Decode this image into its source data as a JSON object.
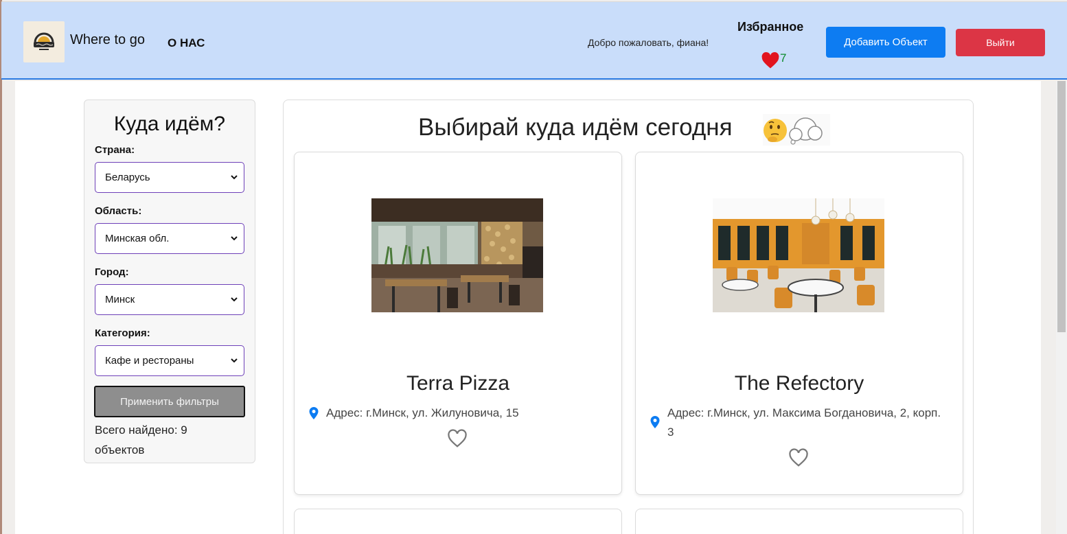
{
  "header": {
    "brand": "Where to go",
    "about_label": "О НАС",
    "welcome": "Добро пожаловать, фиана!",
    "favorites_label": "Избранное",
    "favorites_count": "7",
    "add_object_label": "Добавить Объект",
    "logout_label": "Выйти",
    "colors": {
      "header_bg": "#c9ddfa",
      "add_button": "#0d7cf2",
      "logout_button": "#dc3545",
      "favorites_count": "#0a8a2a"
    }
  },
  "filters": {
    "title": "Куда идём?",
    "country_label": "Страна:",
    "country_value": "Беларусь",
    "region_label": "Область:",
    "region_value": "Минская обл.",
    "city_label": "Город:",
    "city_value": "Минск",
    "category_label": "Категория:",
    "category_value": "Кафе и рестораны",
    "apply_label": "Применить фильтры",
    "found_text": "Всего найдено: 9 объектов"
  },
  "content": {
    "title": "Выбирай куда идём сегодня",
    "title_emoji": "🤔💭",
    "cards": [
      {
        "name": "Terra Pizza",
        "address": "Адрес: г.Минск, ул. Жилуновича, 15",
        "icon": "location-pin-icon"
      },
      {
        "name": "The Refectory",
        "address": "Адрес: г.Минск, ул. Максима Богдановича, 2, корп. 3",
        "icon": "location-pin-icon"
      }
    ]
  }
}
